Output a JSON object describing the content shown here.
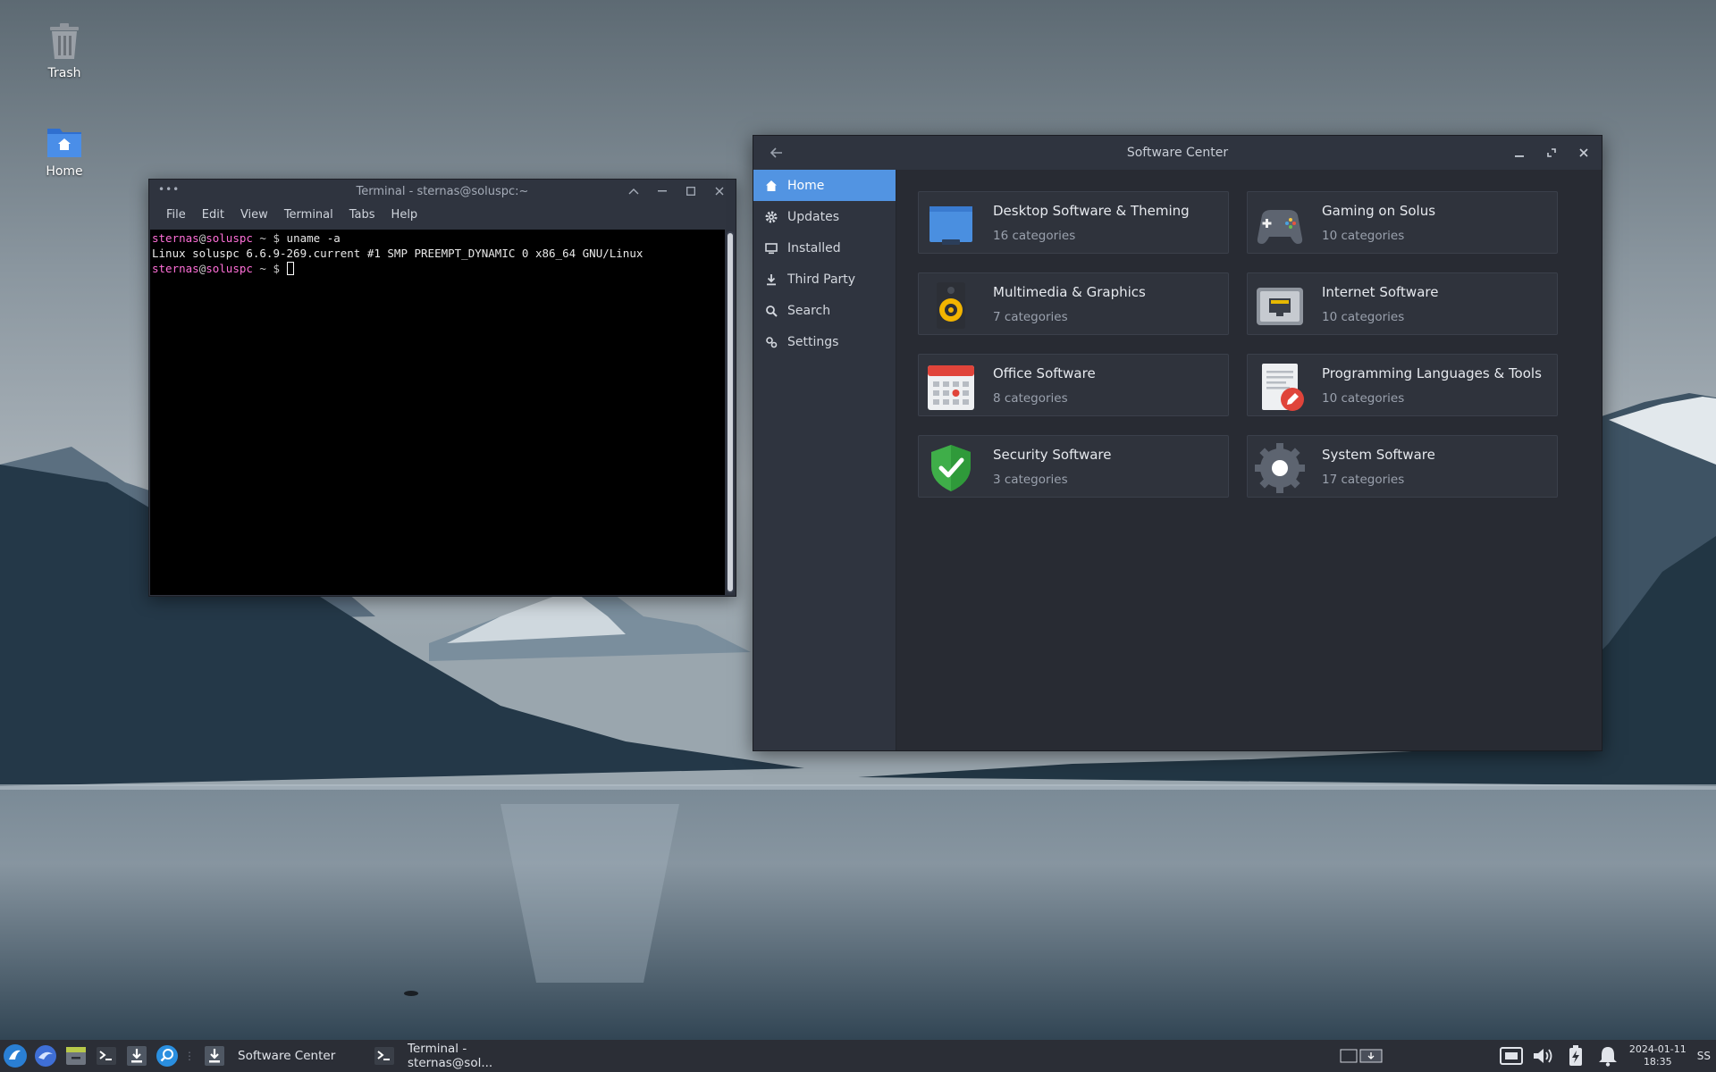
{
  "desktop": {
    "icons": [
      {
        "label": "Trash"
      },
      {
        "label": "Home"
      }
    ]
  },
  "terminal": {
    "title": "Terminal - sternas@soluspc:~",
    "menu": [
      "File",
      "Edit",
      "View",
      "Terminal",
      "Tabs",
      "Help"
    ],
    "lines": [
      {
        "user": "sternas",
        "at": "@",
        "host": "soluspc",
        "path": " ~ $ ",
        "cmd": "uname -a"
      },
      {
        "output": "Linux soluspc 6.6.9-269.current #1 SMP PREEMPT_DYNAMIC 0 x86_64 GNU/Linux"
      },
      {
        "user": "sternas",
        "at": "@",
        "host": "soluspc",
        "path": " ~ $ ",
        "cmd": ""
      }
    ]
  },
  "software_center": {
    "title": "Software Center",
    "nav": [
      {
        "label": "Home",
        "icon": "home-icon",
        "active": true
      },
      {
        "label": "Updates",
        "icon": "gear-icon"
      },
      {
        "label": "Installed",
        "icon": "monitor-icon"
      },
      {
        "label": "Third Party",
        "icon": "download-icon"
      },
      {
        "label": "Search",
        "icon": "search-icon"
      },
      {
        "label": "Settings",
        "icon": "settings-icon"
      }
    ],
    "categories": [
      {
        "title": "Desktop Software & Theming",
        "sub": "16 categories",
        "icon": "desktop-icon"
      },
      {
        "title": "Gaming on Solus",
        "sub": "10 categories",
        "icon": "gamepad-icon"
      },
      {
        "title": "Multimedia & Graphics",
        "sub": "7 categories",
        "icon": "speaker-icon"
      },
      {
        "title": "Internet Software",
        "sub": "10 categories",
        "icon": "network-icon"
      },
      {
        "title": "Office Software",
        "sub": "8 categories",
        "icon": "calendar-icon"
      },
      {
        "title": "Programming Languages & Tools",
        "sub": "10 categories",
        "icon": "text-editor-icon"
      },
      {
        "title": "Security Software",
        "sub": "3 categories",
        "icon": "shield-icon"
      },
      {
        "title": "System Software",
        "sub": "17 categories",
        "icon": "system-gear-icon"
      }
    ],
    "accent": "#5294e2"
  },
  "taskbar": {
    "tasks": [
      {
        "label": "Software Center",
        "icon": "software-center-icon"
      },
      {
        "label": "Terminal - sternas@sol...",
        "icon": "terminal-icon"
      }
    ],
    "clock_date": "2024-01-11",
    "clock_time": "18:35",
    "user_initials": "SS"
  }
}
